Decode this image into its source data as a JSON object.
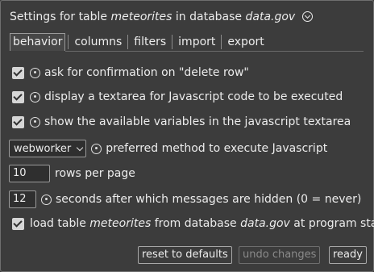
{
  "title": {
    "prefix": "Settings for table",
    "table": "meteorites",
    "mid": "in database",
    "database": "data.gov"
  },
  "tabs": [
    {
      "label": "behavior",
      "active": true
    },
    {
      "label": "columns",
      "active": false
    },
    {
      "label": "filters",
      "active": false
    },
    {
      "label": "import",
      "active": false
    },
    {
      "label": "export",
      "active": false
    }
  ],
  "options": {
    "confirm_delete": {
      "checked": true,
      "label": "ask for confirmation on \"delete row\""
    },
    "js_textarea": {
      "checked": true,
      "label": "display a textarea for Javascript code to be executed"
    },
    "show_vars": {
      "checked": true,
      "label": "show the available variables in the javascript textarea"
    },
    "js_method": {
      "value": "webworker",
      "label": "preferred method to execute Javascript"
    },
    "rows_per_page": {
      "value": "10",
      "label": "rows per page"
    },
    "msg_timeout": {
      "value": "12",
      "label": "seconds after which messages are hidden (0 = never)"
    },
    "load_at_start": {
      "checked": true,
      "prefix": "load table",
      "table": "meteorites",
      "mid": "from database",
      "database": "data.gov",
      "suffix": "at program start"
    }
  },
  "buttons": {
    "reset": "reset to defaults",
    "undo": "undo changes",
    "ready": "ready"
  }
}
